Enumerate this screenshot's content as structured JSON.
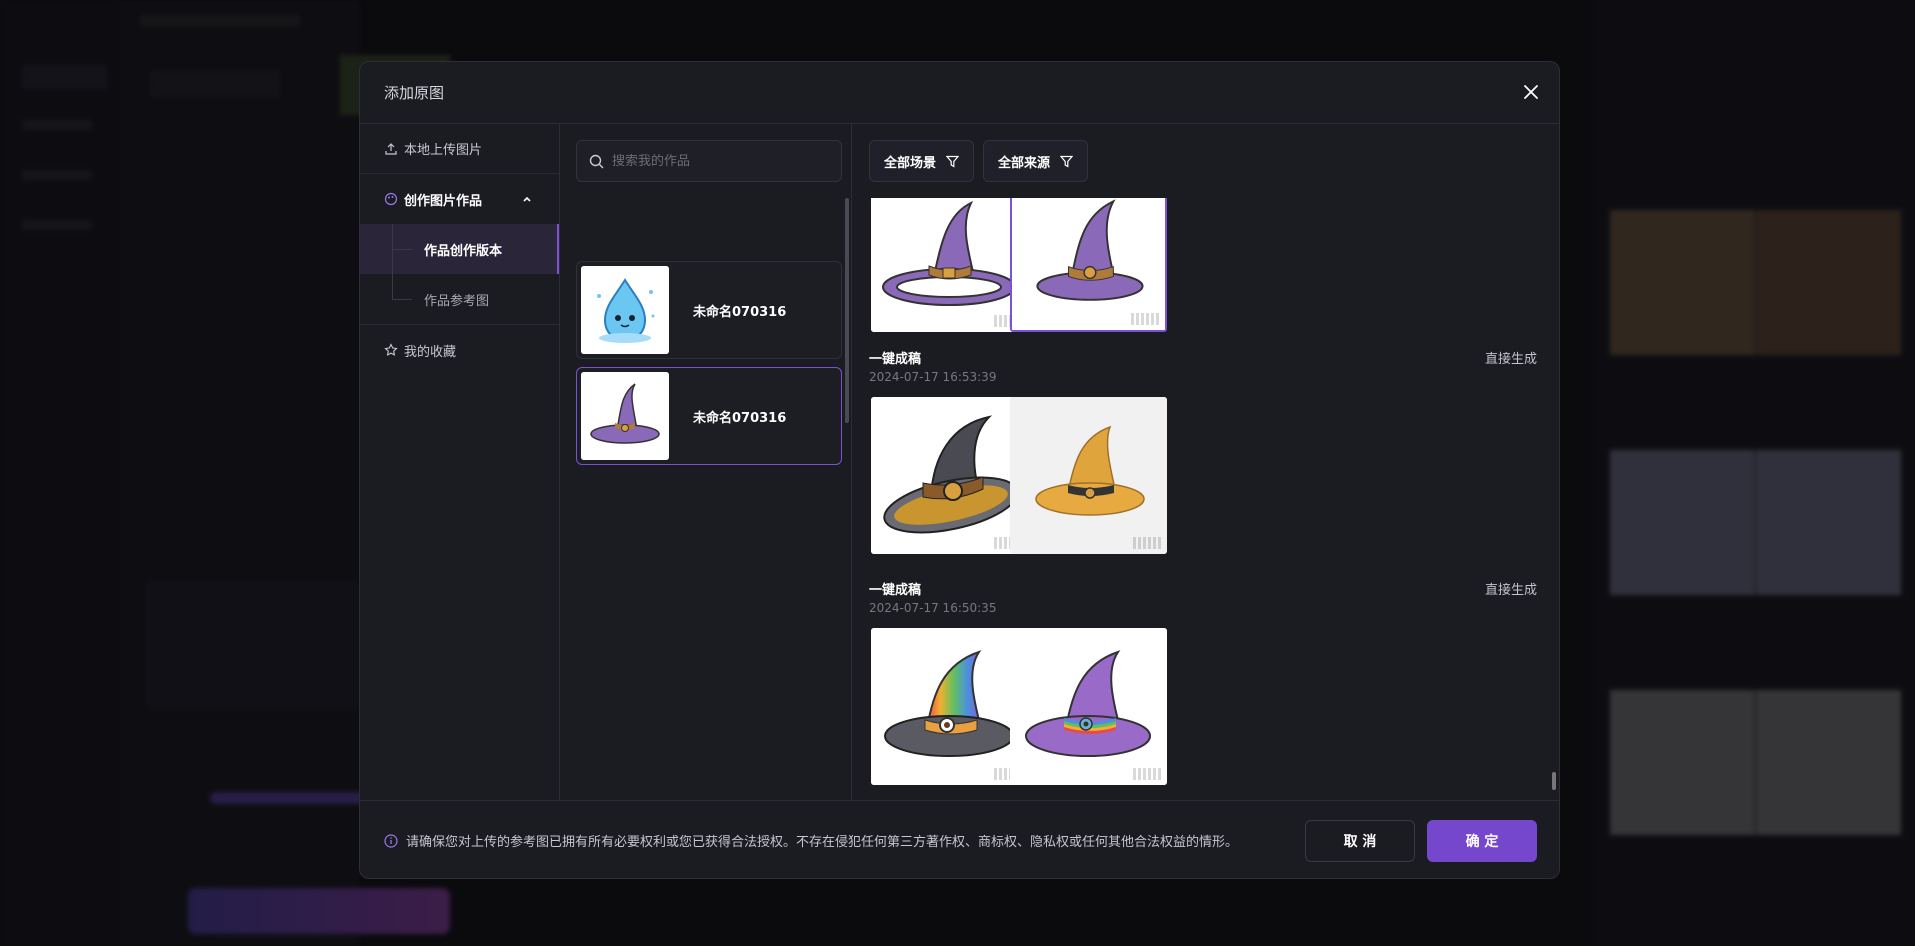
{
  "modal": {
    "title": "添加原图",
    "sidebar": {
      "upload_label": "本地上传图片",
      "works_label": "创作图片作品",
      "sub_items": [
        "作品创作版本",
        "作品参考图"
      ],
      "favorites_label": "我的收藏"
    },
    "search": {
      "placeholder": "搜索我的作品"
    },
    "works": [
      {
        "name": "未命名070316",
        "thumb": "water-drop-character"
      },
      {
        "name": "未命名070316",
        "thumb": "purple-witch-hat"
      }
    ],
    "filters": [
      "全部场景",
      "全部来源"
    ],
    "groups": [
      {
        "title": "一键成稿",
        "date": "2024-07-17 16:53:39",
        "action": "直接生成"
      },
      {
        "title": "一键成稿",
        "date": "2024-07-17 16:50:35",
        "action": "直接生成"
      }
    ],
    "footer": {
      "notice": "请确保您对上传的参考图已拥有所有必要权利或您已获得合法授权。不存在侵犯任何第三方著作权、商标权、隐私权或任何其他合法权益的情形。",
      "cancel": "取 消",
      "confirm": "确 定"
    }
  },
  "colors": {
    "accent": "#7447cc",
    "background": "#1b1b22"
  }
}
